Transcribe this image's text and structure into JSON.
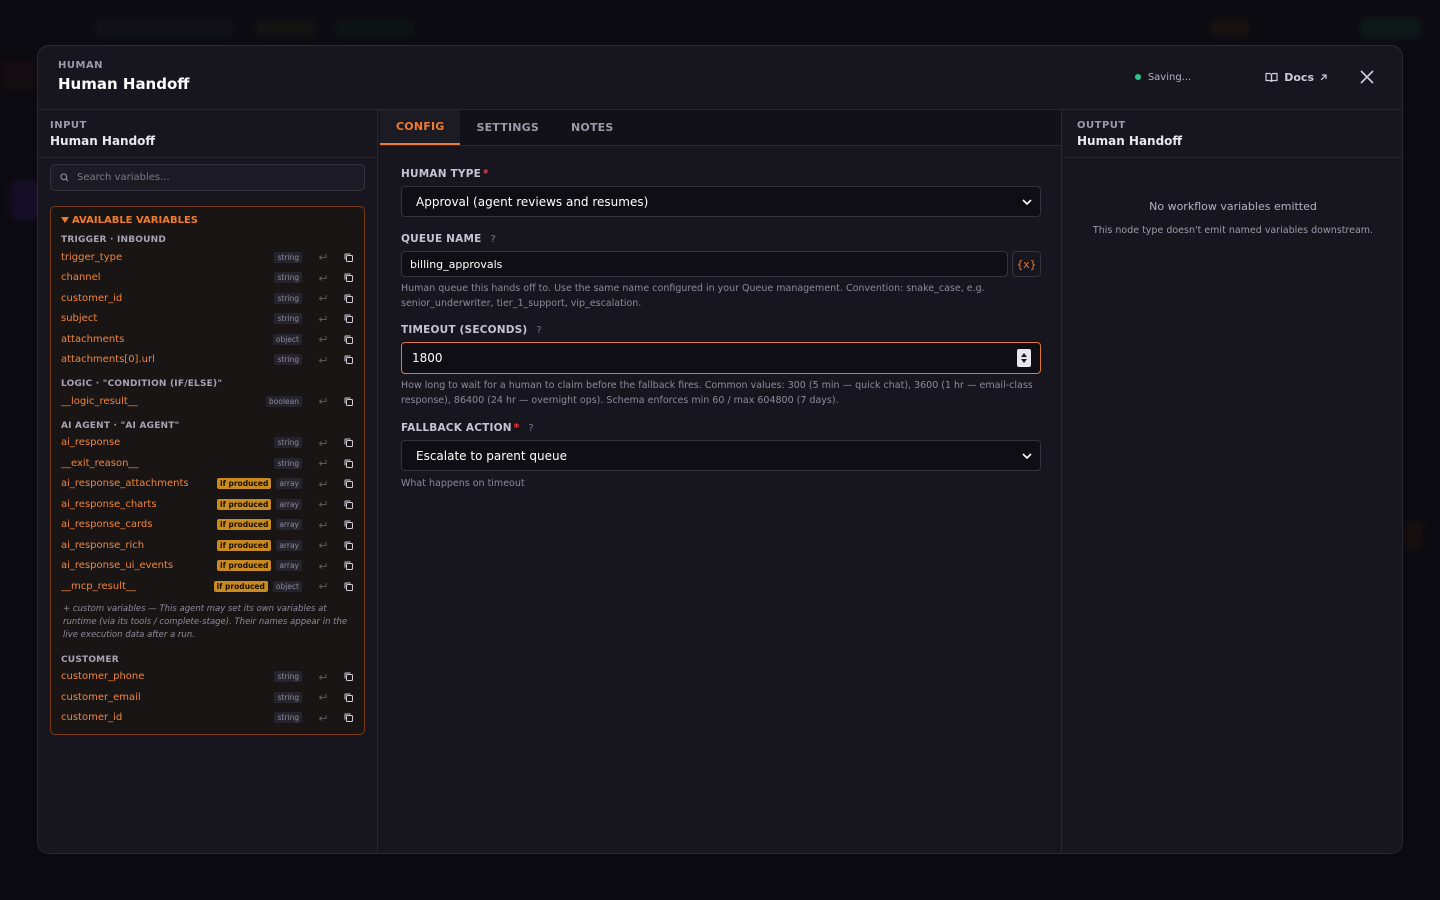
{
  "header": {
    "eyebrow": "HUMAN",
    "title": "Human Handoff",
    "status": "Saving...",
    "docs_label": "Docs"
  },
  "colors": {
    "accent": "#f07a2e",
    "status_dot": "#2bc48a",
    "required": "#f03e3e",
    "if_produced_badge": "#c98a20"
  },
  "input_panel": {
    "eyebrow": "INPUT",
    "title": "Human Handoff",
    "search_placeholder": "Search variables...",
    "section_title": "AVAILABLE VARIABLES",
    "groups": [
      {
        "label": "TRIGGER · INBOUND",
        "vars": [
          {
            "name": "trigger_type",
            "type": "string"
          },
          {
            "name": "channel",
            "type": "string"
          },
          {
            "name": "customer_id",
            "type": "string"
          },
          {
            "name": "subject",
            "type": "string"
          },
          {
            "name": "attachments",
            "type": "object"
          },
          {
            "name": "attachments[0].url",
            "type": "string"
          }
        ]
      },
      {
        "label": "LOGIC · \"CONDITION (IF/ELSE)\"",
        "vars": [
          {
            "name": "__logic_result__",
            "type": "boolean"
          }
        ]
      },
      {
        "label": "AI AGENT · \"AI AGENT\"",
        "vars": [
          {
            "name": "ai_response",
            "type": "string"
          },
          {
            "name": "__exit_reason__",
            "type": "string"
          },
          {
            "name": "ai_response_attachments",
            "type": "array",
            "badge": "if produced"
          },
          {
            "name": "ai_response_charts",
            "type": "array",
            "badge": "if produced"
          },
          {
            "name": "ai_response_cards",
            "type": "array",
            "badge": "if produced"
          },
          {
            "name": "ai_response_rich",
            "type": "array",
            "badge": "if produced"
          },
          {
            "name": "ai_response_ui_events",
            "type": "array",
            "badge": "if produced"
          },
          {
            "name": "__mcp_result__",
            "type": "object",
            "badge": "if produced"
          }
        ],
        "note": "+ custom variables — This agent may set its own variables at runtime (via its tools / complete-stage). Their names appear in the live execution data after a run."
      },
      {
        "label": "CUSTOMER",
        "vars": [
          {
            "name": "customer_phone",
            "type": "string"
          },
          {
            "name": "customer_email",
            "type": "string"
          },
          {
            "name": "customer_id",
            "type": "string"
          }
        ]
      }
    ]
  },
  "tabs": [
    {
      "label": "CONFIG",
      "active": true
    },
    {
      "label": "SETTINGS",
      "active": false
    },
    {
      "label": "NOTES",
      "active": false
    }
  ],
  "config": {
    "human_type": {
      "label": "HUMAN TYPE",
      "value": "Approval (agent reviews and resumes)"
    },
    "queue_name": {
      "label": "QUEUE NAME",
      "value": "billing_approvals",
      "var_button": "{x}",
      "help": "Human queue this hands off to. Use the same name configured in your Queue management. Convention: snake_case, e.g. senior_underwriter, tier_1_support, vip_escalation."
    },
    "timeout": {
      "label": "TIMEOUT (SECONDS)",
      "value": "1800",
      "help": "How long to wait for a human to claim before the fallback fires. Common values: 300 (5 min — quick chat), 3600 (1 hr — email-class response), 86400 (24 hr — overnight ops). Schema enforces min 60 / max 604800 (7 days)."
    },
    "fallback": {
      "label": "FALLBACK ACTION",
      "value": "Escalate to parent queue",
      "help": "What happens on timeout"
    },
    "help_mark": "?",
    "required_mark": "*"
  },
  "output_panel": {
    "eyebrow": "OUTPUT",
    "title": "Human Handoff",
    "empty_title": "No workflow variables emitted",
    "empty_sub": "This node type doesn't emit named variables downstream."
  }
}
